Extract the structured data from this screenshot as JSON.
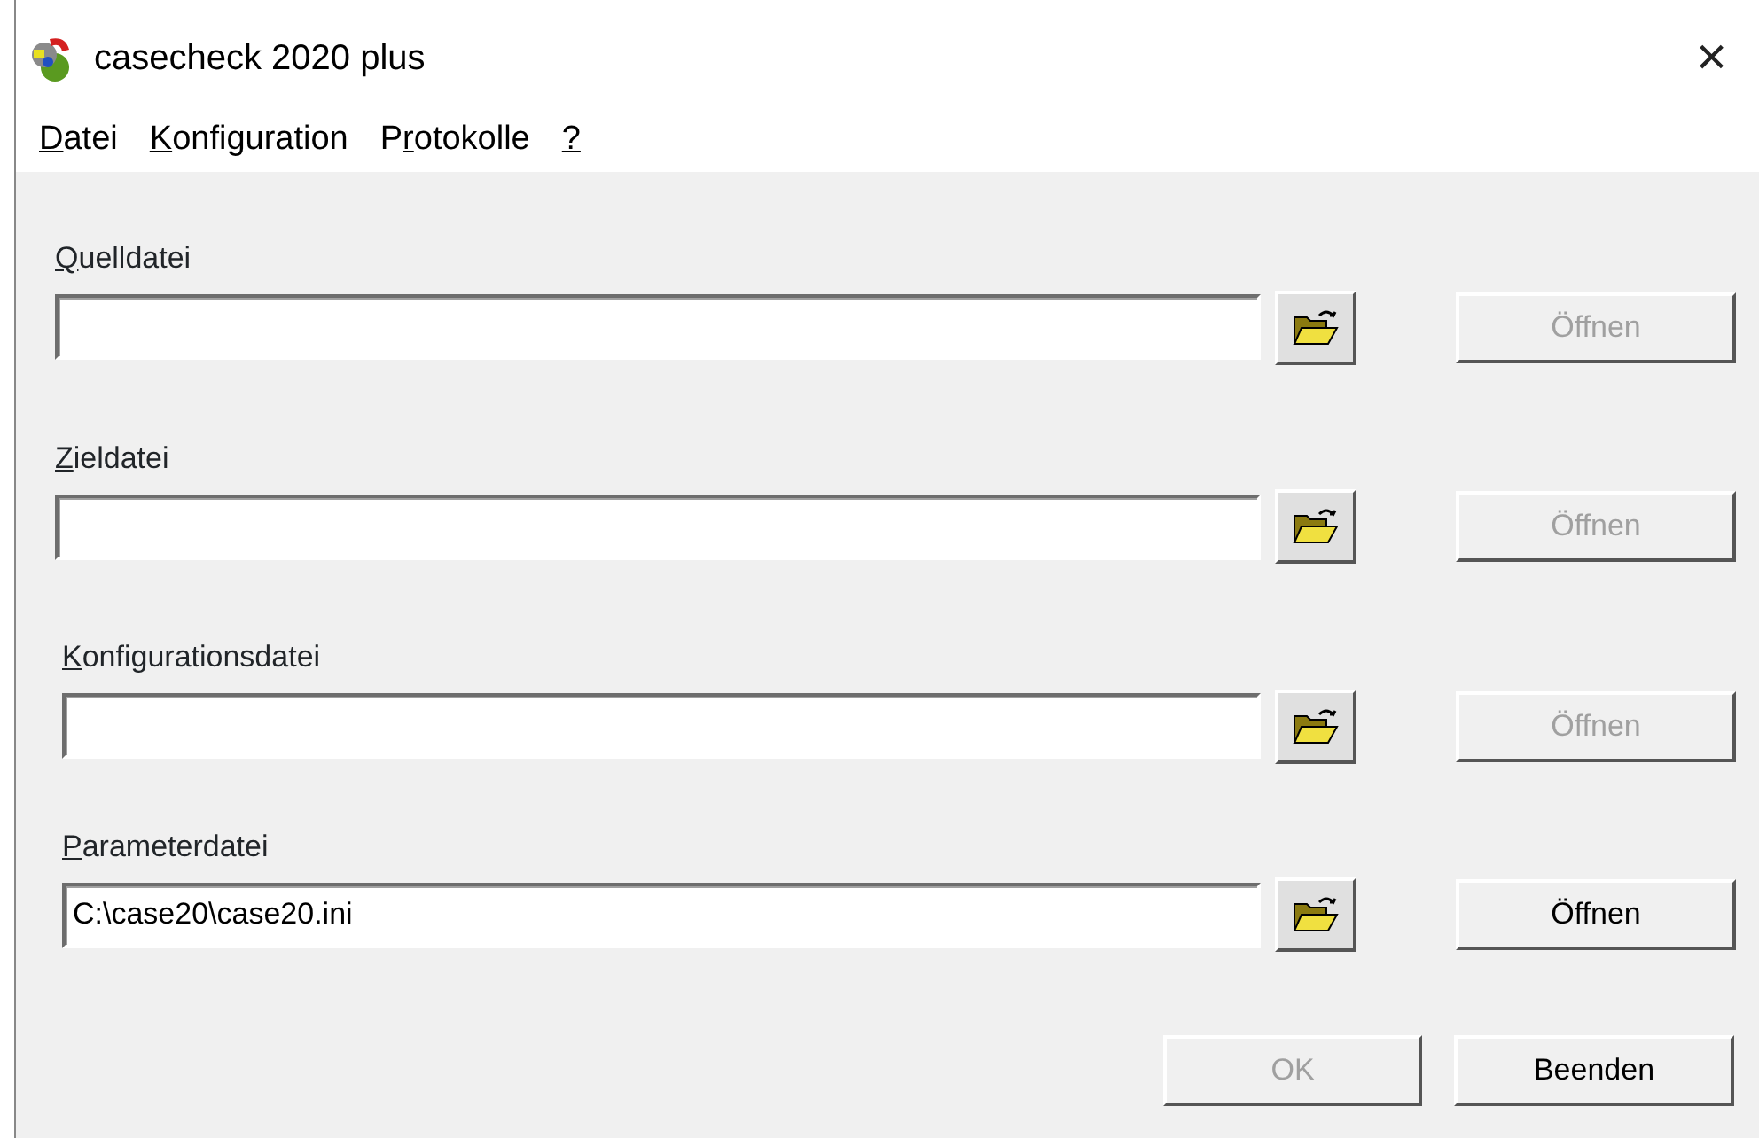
{
  "window": {
    "title": "casecheck 2020 plus",
    "close": "×"
  },
  "menu": [
    {
      "key": "D",
      "suffix": "atei"
    },
    {
      "key": "K",
      "suffix": "onfiguration"
    },
    {
      "prefix": "P",
      "key": "r",
      "suffix": "otokolle"
    },
    {
      "key": "?"
    }
  ],
  "files": [
    {
      "label": {
        "key": "Q",
        "suffix": "uelldatei"
      },
      "open_button": {
        "label": "Öffnen",
        "disabled": true
      }
    },
    {
      "label": {
        "key": "Z",
        "suffix": "ieldatei"
      },
      "open_button": {
        "label": "Öffnen",
        "disabled": true
      }
    },
    {
      "label": {
        "key": "K",
        "suffix": "onfigurationsdatei"
      },
      "open_button": {
        "label": "Öffnen",
        "disabled": true
      }
    },
    {
      "label": {
        "key": "P",
        "suffix": "arameterdatei"
      },
      "value": "C:\\case20\\case20.ini",
      "open_button": {
        "label": "Öffnen",
        "disabled": false
      }
    }
  ],
  "buttons": [
    {
      "label": "OK",
      "disabled": true
    },
    {
      "label": "Beenden",
      "disabled": false
    }
  ]
}
